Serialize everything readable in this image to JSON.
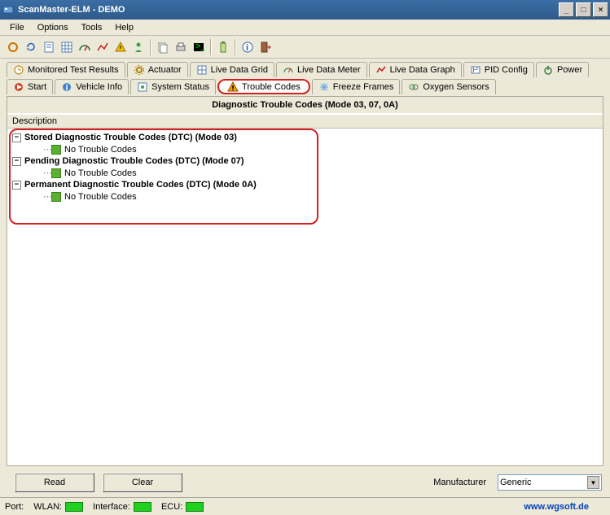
{
  "window": {
    "title": "ScanMaster-ELM - DEMO"
  },
  "menu": {
    "file": "File",
    "options": "Options",
    "tools": "Tools",
    "help": "Help"
  },
  "tabs_row1": [
    {
      "label": "Monitored Test Results",
      "icon": "clock"
    },
    {
      "label": "Actuator",
      "icon": "gear"
    },
    {
      "label": "Live Data Grid",
      "icon": "grid"
    },
    {
      "label": "Live Data Meter",
      "icon": "meter"
    },
    {
      "label": "Live Data Graph",
      "icon": "graph"
    },
    {
      "label": "PID Config",
      "icon": "pid"
    },
    {
      "label": "Power",
      "icon": "power"
    }
  ],
  "tabs_row2": [
    {
      "label": "Start",
      "icon": "start"
    },
    {
      "label": "Vehicle Info",
      "icon": "info"
    },
    {
      "label": "System Status",
      "icon": "status"
    },
    {
      "label": "Trouble Codes",
      "icon": "warning",
      "active": true
    },
    {
      "label": "Freeze Frames",
      "icon": "freeze"
    },
    {
      "label": "Oxygen Sensors",
      "icon": "o2"
    }
  ],
  "panel": {
    "title": "Diagnostic Trouble Codes (Mode 03, 07, 0A)",
    "description_header": "Description",
    "items": [
      {
        "label": "Stored Diagnostic Trouble Codes (DTC) (Mode 03)",
        "child": "No Trouble Codes"
      },
      {
        "label": "Pending Diagnostic Trouble Codes (DTC) (Mode 07)",
        "child": "No Trouble Codes"
      },
      {
        "label": "Permanent Diagnostic Trouble Codes (DTC) (Mode 0A)",
        "child": "No Trouble Codes"
      }
    ]
  },
  "buttons": {
    "read": "Read",
    "clear": "Clear"
  },
  "manufacturer": {
    "label": "Manufacturer",
    "value": "Generic"
  },
  "status": {
    "port": "Port:",
    "wlan": "WLAN:",
    "interface": "Interface:",
    "ecu": "ECU:",
    "url": "www.wgsoft.de"
  }
}
